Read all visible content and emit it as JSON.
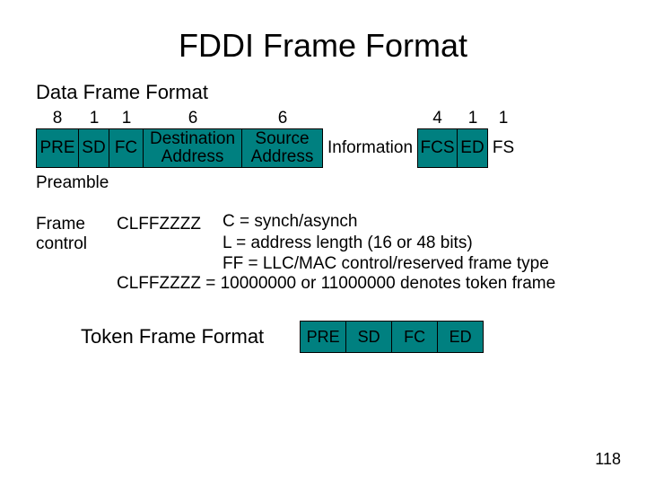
{
  "title": "FDDI Frame Format",
  "data_frame_label": "Data Frame Format",
  "frame_widths": [
    "8",
    "1",
    "1",
    "6",
    "6",
    "",
    "4",
    "1",
    "1"
  ],
  "frame_cells": [
    "PRE",
    "SD",
    "FC",
    "Destination Address",
    "Source Address",
    "Information",
    "FCS",
    "ED",
    "FS"
  ],
  "preamble_label": "Preamble",
  "fc_left_lines": [
    "Frame",
    "control"
  ],
  "fc_code": "CLFFZZZZ",
  "fc_lines": [
    "C = synch/asynch",
    "L = address length (16 or 48 bits)",
    "FF = LLC/MAC control/reserved frame type"
  ],
  "fc_long": "CLFFZZZZ = 10000000 or 11000000 denotes token frame",
  "token_label": "Token Frame Format",
  "token_cells": [
    "PRE",
    "SD",
    "FC",
    "ED"
  ],
  "page_number": "118"
}
